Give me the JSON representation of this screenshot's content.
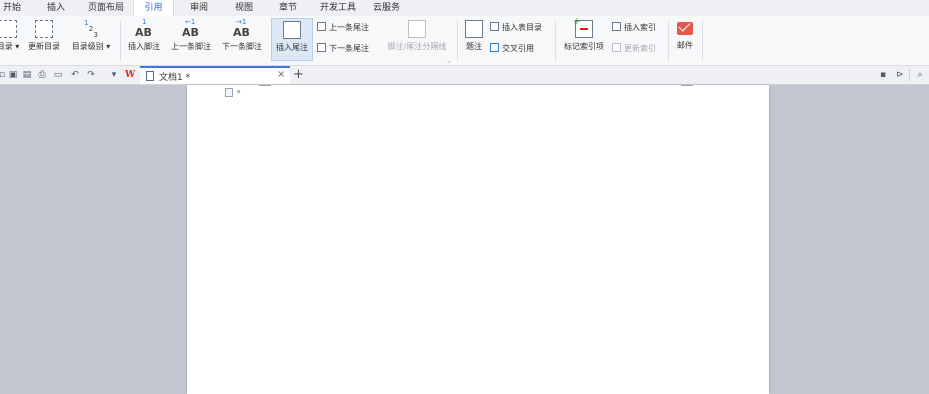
{
  "menu": {
    "items": [
      "开始",
      "插入",
      "页面布局",
      "引用",
      "审阅",
      "视图",
      "章节",
      "开发工具",
      "云服务"
    ],
    "active": "引用"
  },
  "ribbon": {
    "toc_label": "目录",
    "update_toc_label": "更新目录",
    "toc_level_label": "目录级别",
    "insert_footnote_label": "插入脚注",
    "prev_footnote_label": "上一条脚注",
    "next_footnote_label": "下一条脚注",
    "insert_endnote_label": "插入尾注",
    "prev_endnote_label": "上一条尾注",
    "next_endnote_label": "下一条尾注",
    "separator_label": "脚注/尾注分隔线",
    "caption_label": "题注",
    "insert_table_of_figures_label": "插入表目录",
    "cross_reference_label": "交叉引用",
    "mark_index_label": "标记索引项",
    "insert_index_label": "插入索引",
    "update_index_label": "更新索引",
    "mail_label": "邮件",
    "ab_text": "AB",
    "level_digits": [
      "1",
      "2",
      "3"
    ],
    "footnote_sup": "1"
  },
  "document_tab": {
    "title": "文档1 *",
    "close_glyph": "×",
    "new_tab_glyph": "+"
  },
  "colors": {
    "accent": "#2e6fd1",
    "wps_logo": "#d9261c",
    "mail_icon": "#e35a4d"
  }
}
